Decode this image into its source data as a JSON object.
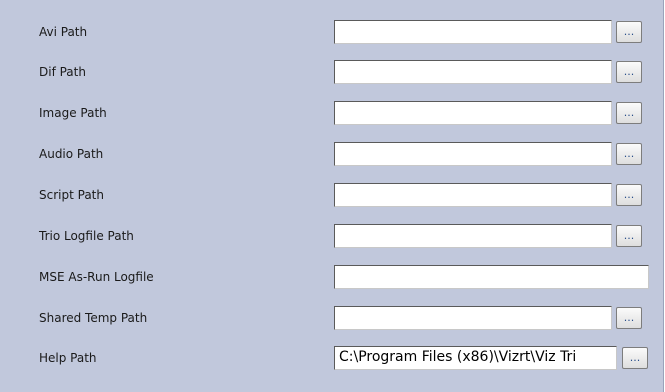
{
  "fields": [
    {
      "label": "Avi Path",
      "value": "",
      "browse_label": "..."
    },
    {
      "label": "Dif Path",
      "value": "",
      "browse_label": "..."
    },
    {
      "label": "Image Path",
      "value": "",
      "browse_label": "..."
    },
    {
      "label": "Audio Path",
      "value": "",
      "browse_label": "..."
    },
    {
      "label": "Script Path",
      "value": "",
      "browse_label": "..."
    },
    {
      "label": "Trio Logfile Path",
      "value": "",
      "browse_label": "..."
    },
    {
      "label": "MSE As-Run Logfile",
      "value": ""
    },
    {
      "label": "Shared Temp Path",
      "value": "",
      "browse_label": "..."
    },
    {
      "label": "Help Path",
      "value": "C:\\Program Files (x86)\\Vizrt\\Viz Tri",
      "browse_label": "..."
    }
  ]
}
